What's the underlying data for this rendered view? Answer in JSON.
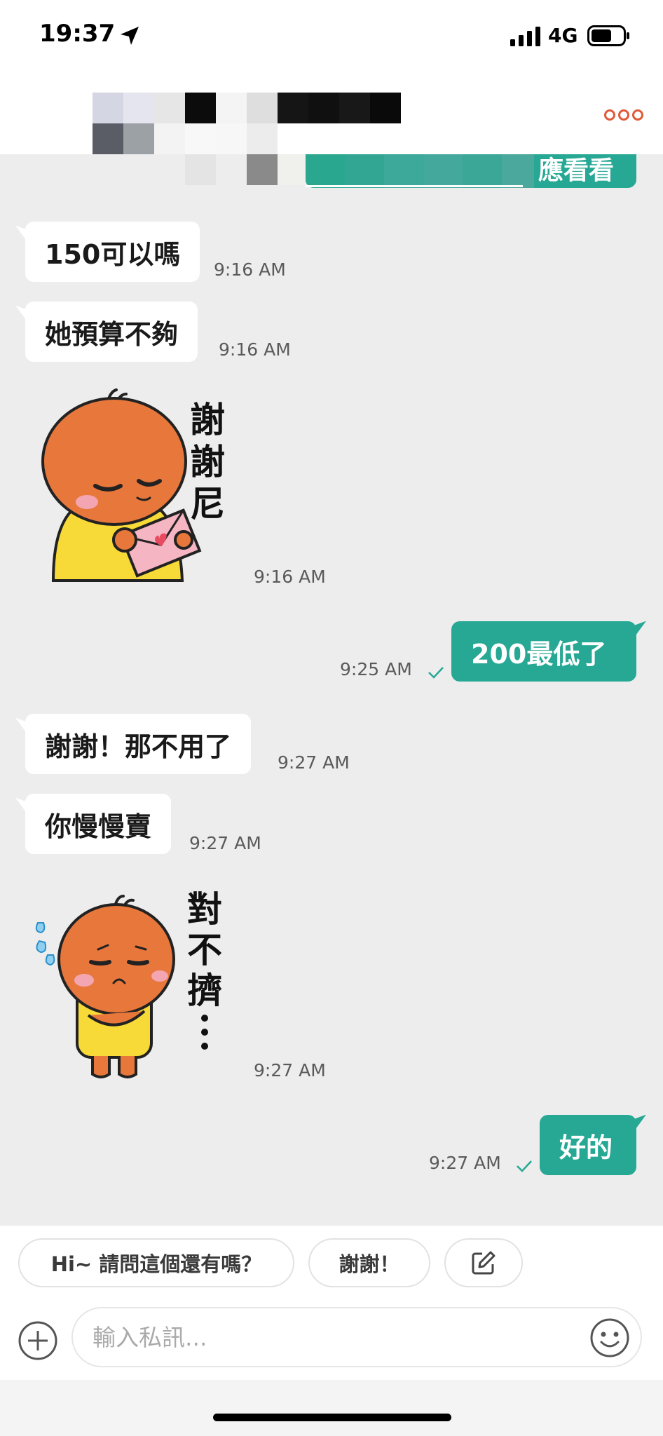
{
  "status_bar": {
    "time": "19:37",
    "network": "4G",
    "icons": [
      "location-arrow-icon",
      "signal-bars-icon",
      "battery-icon"
    ]
  },
  "header": {
    "menu_icon": "more-dots-icon",
    "partial_bubble_text": "應看看"
  },
  "messages": [
    {
      "dir": "in",
      "type": "text",
      "text": "150可以嗎",
      "time": "9:16 AM"
    },
    {
      "dir": "in",
      "type": "text",
      "text": "她預算不夠",
      "time": "9:16 AM"
    },
    {
      "dir": "in",
      "type": "sticker",
      "sticker_text": "謝謝尼",
      "time": "9:16 AM"
    },
    {
      "dir": "out",
      "type": "text",
      "text": "200最低了",
      "time": "9:25 AM"
    },
    {
      "dir": "in",
      "type": "text",
      "text": "謝謝！那不用了",
      "time": "9:27 AM"
    },
    {
      "dir": "in",
      "type": "text",
      "text": "你慢慢賣",
      "time": "9:27 AM"
    },
    {
      "dir": "in",
      "type": "sticker",
      "sticker_text": "對不擠…",
      "time": "9:27 AM"
    },
    {
      "dir": "out",
      "type": "text",
      "text": "好的",
      "time": "9:27 AM"
    }
  ],
  "quick_replies": [
    "Hi~ 請問這個還有嗎？",
    "謝謝！"
  ],
  "quick_reply_edit_icon": "edit-icon",
  "input": {
    "placeholder": "輸入私訊..."
  },
  "colors": {
    "accent": "#26a894",
    "background": "#ededed",
    "menu_dots": "#e05a3a",
    "sticker_face": "#e8773b",
    "sticker_shirt": "#f7d938"
  }
}
